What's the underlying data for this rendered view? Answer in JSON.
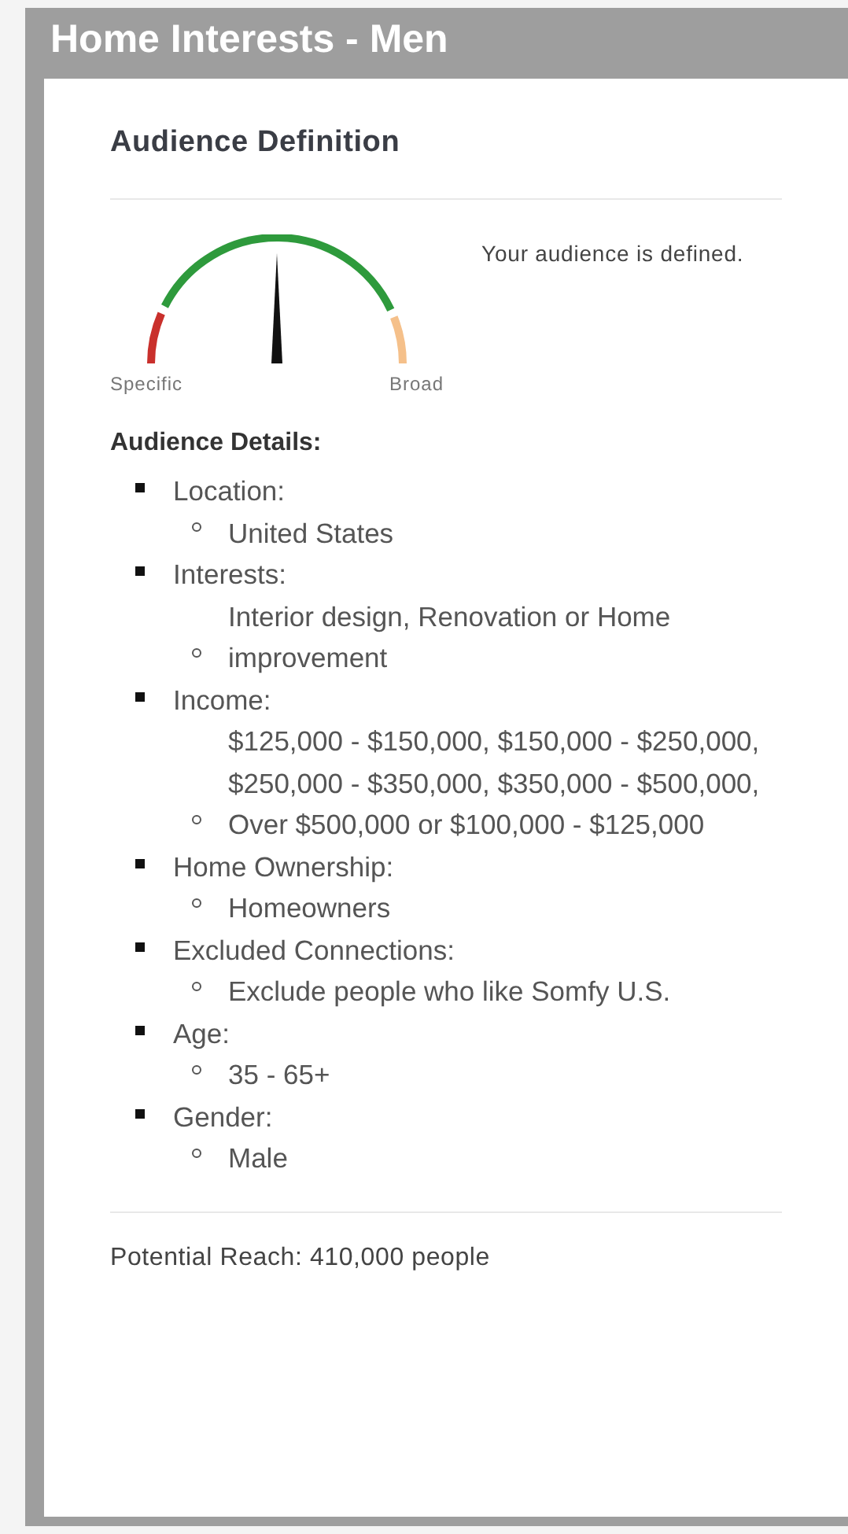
{
  "window": {
    "title": "Home Interests - Men"
  },
  "section_title": "Audience Definition",
  "gauge": {
    "level": 0.5,
    "low_label": "Specific",
    "high_label": "Broad",
    "message": "Your audience is defined."
  },
  "details": {
    "heading": "Audience Details:",
    "items": [
      {
        "label": "Location:",
        "children": [
          {
            "label": "United States"
          }
        ]
      },
      {
        "label": "Interests:",
        "children": [
          {
            "label": "Interior design, Renovation or Home improvement"
          }
        ]
      },
      {
        "label": "Income:",
        "children": [
          {
            "label": "$125,000 - $150,000, $150,000 - $250,000, $250,000 - $350,000, $350,000 - $500,000, Over $500,000 or $100,000 - $125,000"
          }
        ]
      },
      {
        "label": "Home Ownership:",
        "children": [
          {
            "label": "Homeowners"
          }
        ]
      },
      {
        "label": "Excluded Connections:",
        "children": [
          {
            "label": "Exclude people who like Somfy U.S."
          }
        ]
      },
      {
        "label": "Age:",
        "children": [
          {
            "label": "35 - 65+"
          }
        ]
      },
      {
        "label": "Gender:",
        "children": [
          {
            "label": "Male"
          }
        ]
      }
    ]
  },
  "potential_reach": "Potential Reach: 410,000 people"
}
